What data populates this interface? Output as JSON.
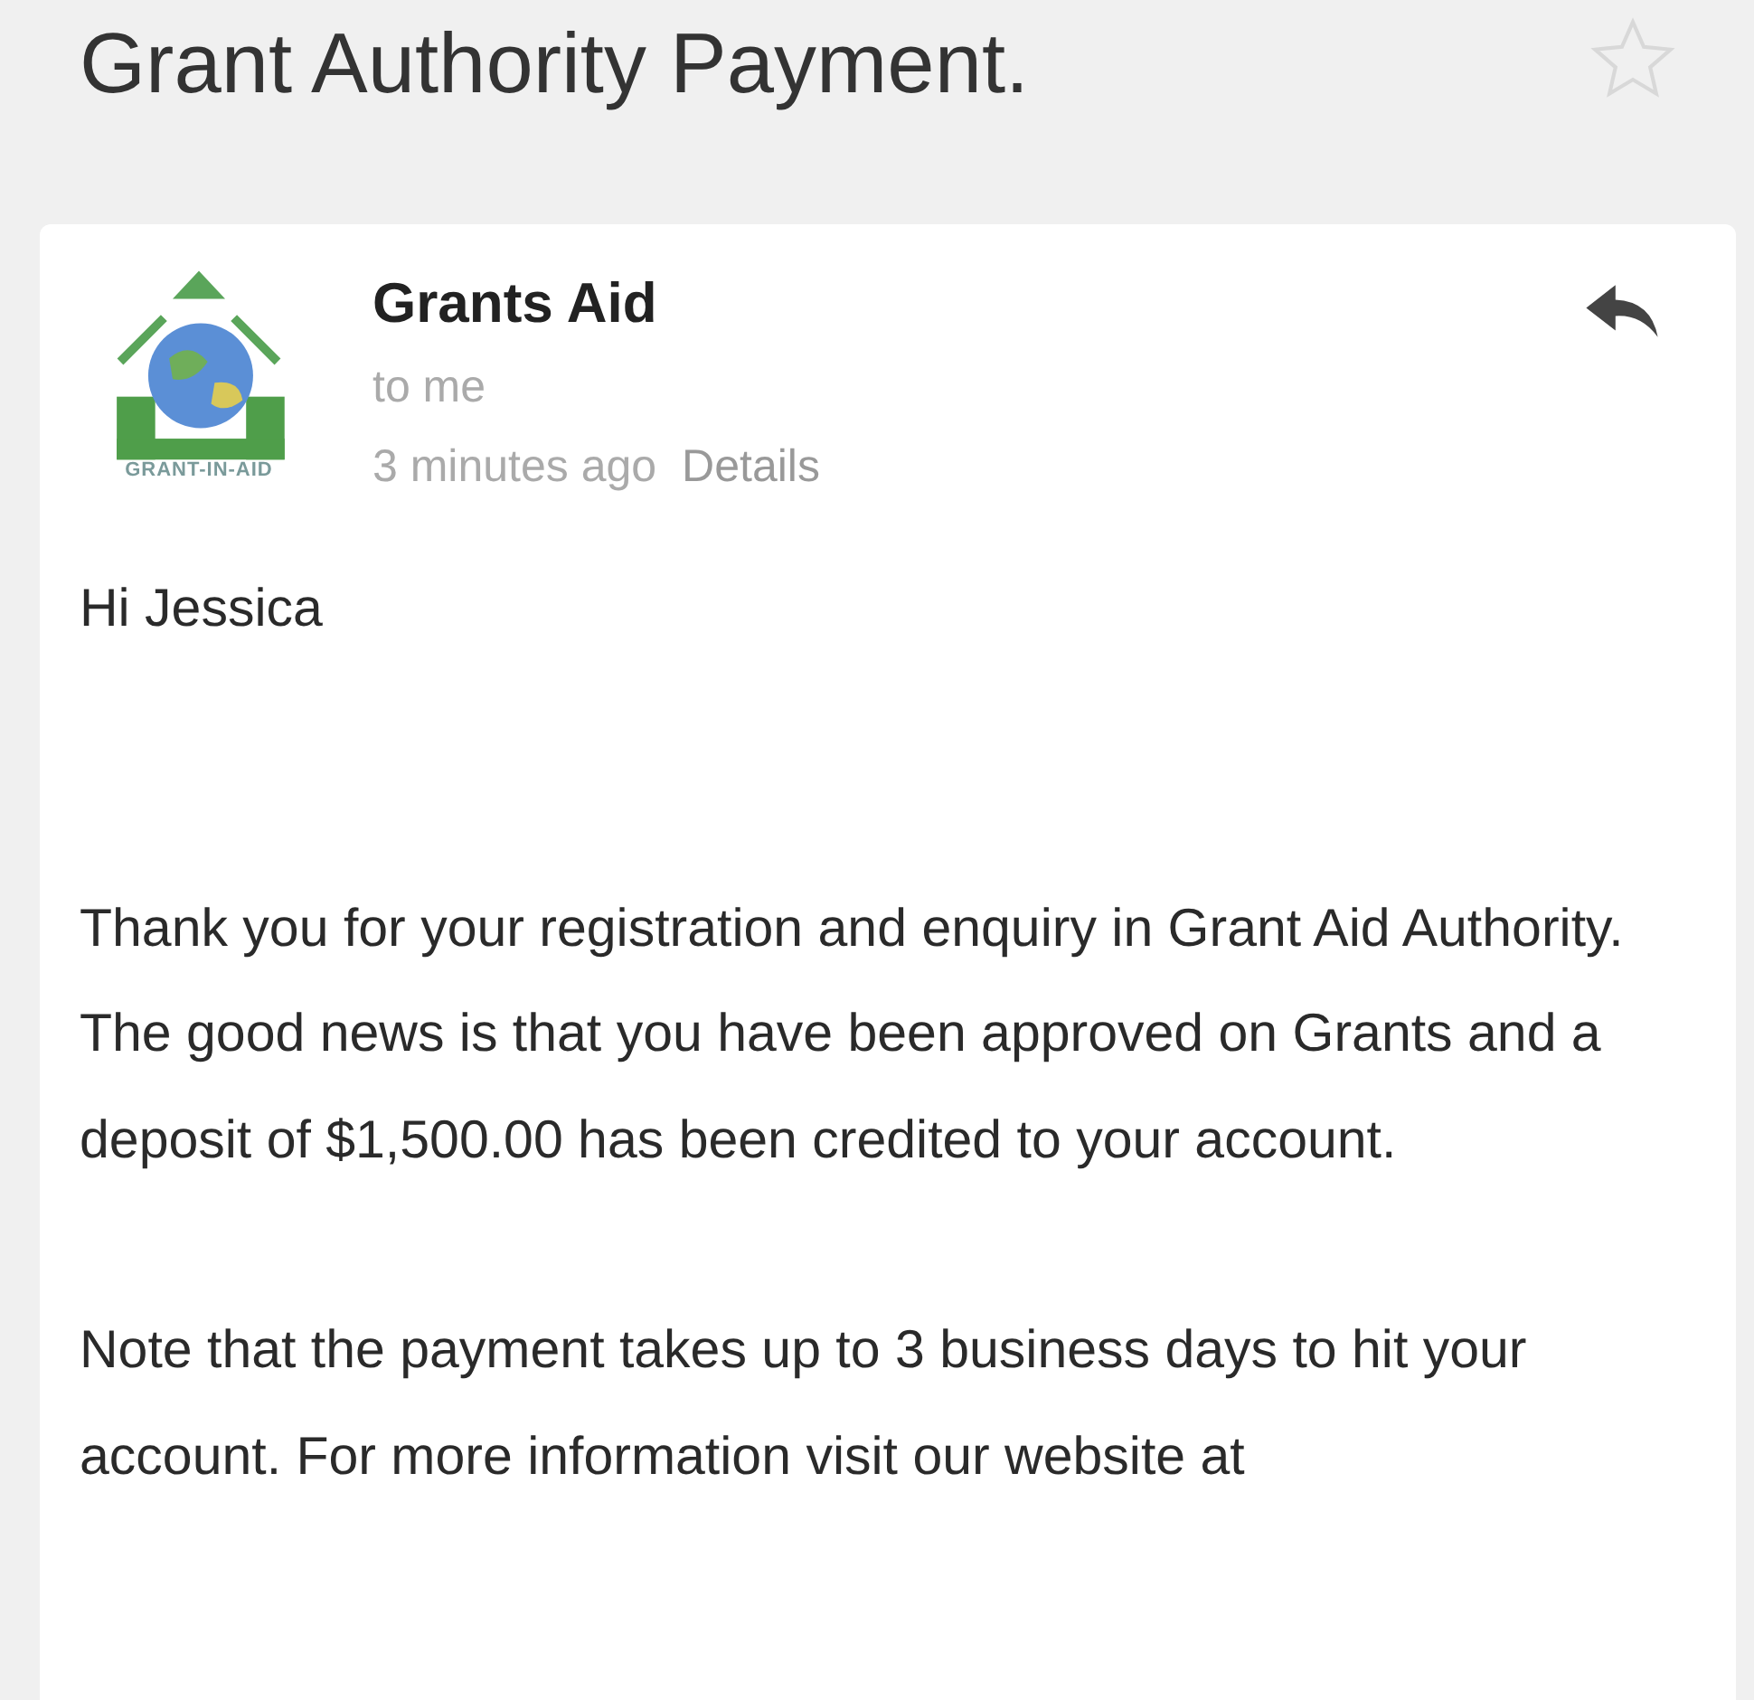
{
  "subject": {
    "title": "Grant Authority Payment.",
    "starred": false
  },
  "message": {
    "sender": "Grants Aid",
    "logo_caption": "GRANT-IN-AID",
    "recipient": "to me",
    "time": "3 minutes ago",
    "details_link": "Details",
    "body": [
      "Hi Jessica",
      "Thank you for your registration and enquiry in Grant Aid Authority. The good news is that you have been approved on Grants and a deposit of $1,500.00 has been credited to your account.",
      "Note that the payment takes up to 3 business days to hit your account. For more information visit our website at"
    ]
  }
}
